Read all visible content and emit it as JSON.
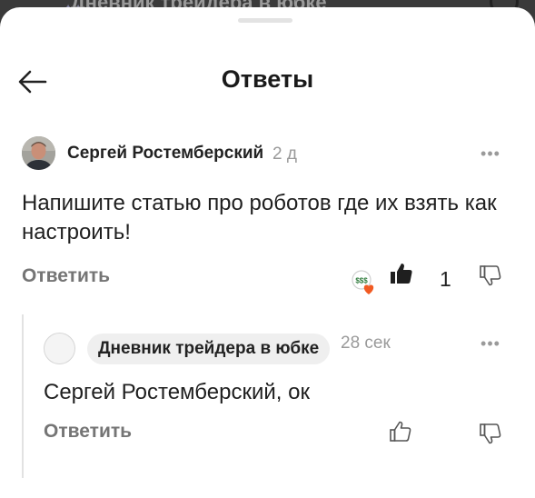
{
  "backdrop": {
    "title": "Дневник трейдера в юбке"
  },
  "header": {
    "title": "Ответы"
  },
  "comment": {
    "author": "Сергей Ростемберский",
    "time": "2 д",
    "text": "Напишите статью про роботов где их взять как настроить!",
    "reply_label": "Ответить",
    "like_count": "1",
    "reaction_badge_text": "$$$"
  },
  "reply": {
    "author": "Дневник трейдера в юбке",
    "time": "28 сек",
    "text": "Сергей Ростемберский, ок",
    "reply_label": "Ответить"
  },
  "colors": {
    "muted": "#9a9a9a",
    "chip_bg": "#efefef",
    "heart": "#f15a22"
  }
}
